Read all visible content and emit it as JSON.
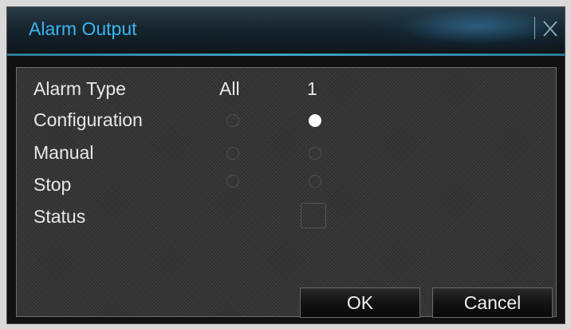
{
  "dialog": {
    "title": "Alarm Output",
    "close_icon": "close-icon"
  },
  "table": {
    "header": {
      "label": "Alarm Type",
      "col_all": "All",
      "col_1": "1"
    },
    "rows": [
      {
        "label": "Configuration",
        "all_selected": false,
        "ch1_selected": true
      },
      {
        "label": "Manual",
        "all_selected": false,
        "ch1_selected": false
      },
      {
        "label": "Stop",
        "all_selected": false,
        "ch1_selected": false
      }
    ],
    "status": {
      "label": "Status",
      "checked": false
    }
  },
  "buttons": {
    "ok": "OK",
    "cancel": "Cancel"
  },
  "colors": {
    "title_text": "#39b6f0",
    "accent_line": "#3fa1c6",
    "dialog_bg": "#111111",
    "panel_bg": "#2e2e2e",
    "text": "#e8e8e8",
    "radio_selected": "#ffffff"
  }
}
